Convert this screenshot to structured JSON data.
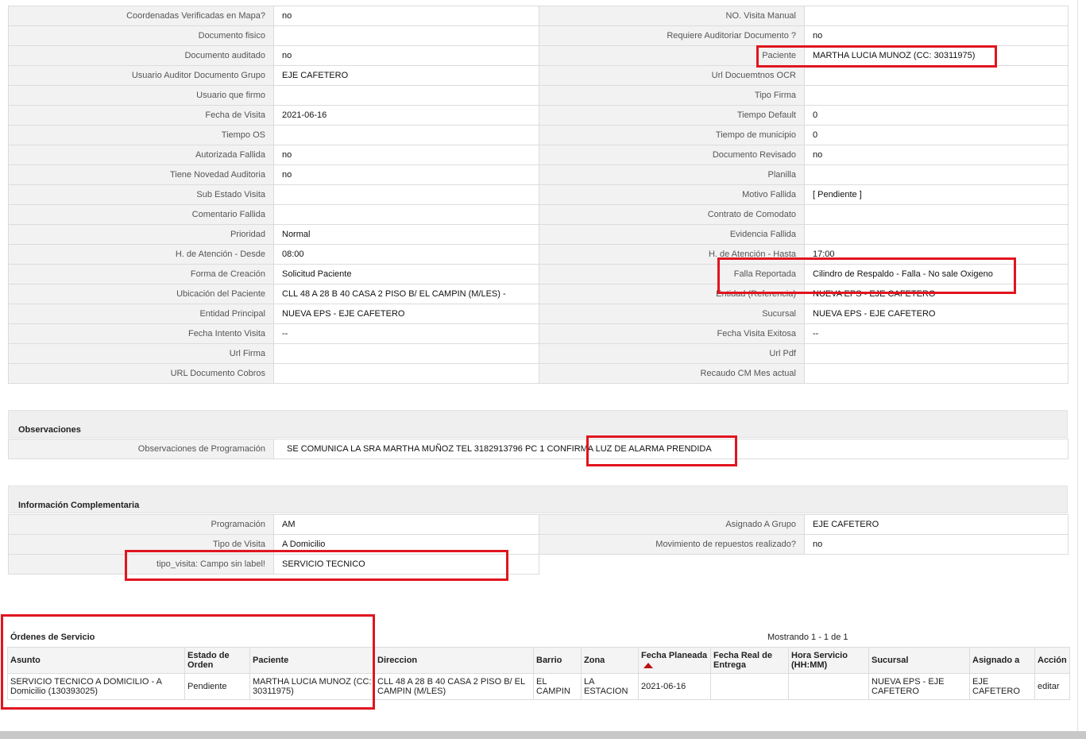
{
  "detail_rows": [
    {
      "l1": "Coordenadas Verificadas en Mapa?",
      "v1": "no",
      "l2": "NO. Visita Manual",
      "v2": ""
    },
    {
      "l1": "Documento fisico",
      "v1": "",
      "l2": "Requiere Auditoriar Documento ?",
      "v2": "no"
    },
    {
      "l1": "Documento auditado",
      "v1": "no",
      "l2": "Paciente",
      "v2": "MARTHA LUCIA MUNOZ (CC: 30311975)"
    },
    {
      "l1": "Usuario Auditor Documento Grupo",
      "v1": "EJE CAFETERO",
      "l2": "Url Docuemtnos OCR",
      "v2": ""
    },
    {
      "l1": "Usuario que firmo",
      "v1": "",
      "l2": "Tipo Firma",
      "v2": ""
    },
    {
      "l1": "Fecha de Visita",
      "v1": "2021-06-16",
      "l2": "Tiempo Default",
      "v2": "0"
    },
    {
      "l1": "Tiempo OS",
      "v1": "",
      "l2": "Tiempo de municipio",
      "v2": "0"
    },
    {
      "l1": "Autorizada Fallida",
      "v1": "no",
      "l2": "Documento Revisado",
      "v2": "no"
    },
    {
      "l1": "Tiene Novedad Auditoria",
      "v1": "no",
      "l2": "Planilla",
      "v2": ""
    },
    {
      "l1": "Sub Estado Visita",
      "v1": "",
      "l2": "Motivo Fallida",
      "v2": "[ Pendiente ]"
    },
    {
      "l1": "Comentario Fallida",
      "v1": "",
      "l2": "Contrato de Comodato",
      "v2": ""
    },
    {
      "l1": "Prioridad",
      "v1": "Normal",
      "l2": "Evidencia Fallida",
      "v2": ""
    },
    {
      "l1": "H. de Atención - Desde",
      "v1": "08:00",
      "l2": "H. de Atención - Hasta",
      "v2": "17:00"
    },
    {
      "l1": "Forma de Creación",
      "v1": "Solicitud Paciente",
      "l2": "Falla Reportada",
      "v2": "Cilindro de Respaldo - Falla - No sale Oxigeno"
    },
    {
      "l1": "Ubicación del Paciente",
      "v1": "CLL 48 A 28 B 40 CASA 2 PISO B/ EL CAMPIN (M/LES) -",
      "l2": "Entidad (Referencia)",
      "v2": "NUEVA EPS - EJE CAFETERO"
    },
    {
      "l1": "Entidad Principal",
      "v1": "NUEVA EPS - EJE CAFETERO",
      "l2": "Sucursal",
      "v2": "NUEVA EPS - EJE CAFETERO"
    },
    {
      "l1": "Fecha Intento Visita",
      "v1": "--",
      "l2": "Fecha Visita Exitosa",
      "v2": "--"
    },
    {
      "l1": "Url Firma",
      "v1": "",
      "l2": "Url Pdf",
      "v2": ""
    },
    {
      "l1": "URL Documento Cobros",
      "v1": "",
      "l2": "Recaudo CM Mes actual",
      "v2": ""
    }
  ],
  "observaciones": {
    "title": "Observaciones",
    "label": "Observaciones de Programación",
    "value": "SE COMUNICA LA SRA MARTHA MUÑOZ TEL 3182913796 PC 1 CONFIRMA LUZ DE ALARMA PRENDIDA"
  },
  "info": {
    "title": "Información Complementaria",
    "rows": [
      {
        "l1": "Programación",
        "v1": "AM",
        "l2": "Asignado A Grupo",
        "v2": "EJE CAFETERO"
      },
      {
        "l1": "Tipo de Visita",
        "v1": "A Domicilio",
        "l2": "Movimiento de repuestos realizado?",
        "v2": "no"
      }
    ],
    "last_label": "tipo_visita: Campo sin label!",
    "last_value": "SERVICIO TECNICO"
  },
  "orders": {
    "title": "Órdenes de Servicio",
    "count_text": "Mostrando 1 - 1 de 1",
    "headers": [
      "Asunto",
      "Estado de Orden",
      "Paciente",
      "Direccion",
      "Barrio",
      "Zona",
      "Fecha Planeada",
      "Fecha Real de Entrega",
      "Hora Servicio (HH:MM)",
      "Sucursal",
      "Asignado a",
      "Acción"
    ],
    "row": {
      "asunto": "SERVICIO TECNICO A DOMICILIO - A Domicilio (130393025)",
      "estado": "Pendiente",
      "paciente": "MARTHA LUCIA MUNOZ (CC: 30311975)",
      "direccion": "CLL 48 A 28 B 40 CASA 2 PISO B/ EL CAMPIN (M/LES)",
      "barrio": "EL CAMPIN",
      "zona": "LA ESTACION",
      "fecha_planeada": "2021-06-16",
      "fecha_real": "",
      "hora": "",
      "sucursal": "NUEVA EPS - EJE CAFETERO",
      "asignado": "EJE CAFETERO",
      "accion": "editar"
    }
  },
  "colors": {
    "highlight": "#e0151f",
    "label_bg": "#f2f2f2",
    "sort_arrow": "#bb1111"
  },
  "icons": {
    "sort": "sort-ascending-icon"
  }
}
